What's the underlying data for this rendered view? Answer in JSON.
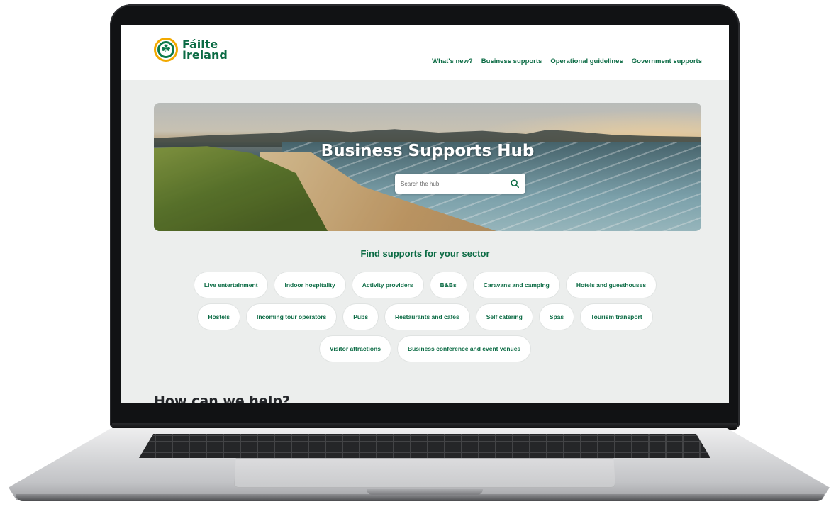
{
  "brand": {
    "logo_line1": "Fáilte",
    "logo_line2": "Ireland",
    "logo_icon": "shamrock-icon",
    "colors": {
      "primary_green": "#0b6b44",
      "logo_ring": "#f2a900"
    }
  },
  "nav": {
    "items": [
      "What's new?",
      "Business supports",
      "Operational guidelines",
      "Government supports"
    ]
  },
  "hero": {
    "title": "Business Supports Hub",
    "search_placeholder": "Search the hub",
    "search_icon": "search-icon"
  },
  "sectors": {
    "heading": "Find supports for your sector",
    "row1": [
      "Live entertainment",
      "Indoor hospitality",
      "Activity providers",
      "B&Bs",
      "Caravans and camping",
      "Hotels and guesthouses"
    ],
    "row2": [
      "Hostels",
      "Incoming tour operators",
      "Pubs",
      "Restaurants and cafes",
      "Self catering",
      "Spas",
      "Tourism transport"
    ],
    "row3": [
      "Visitor attractions",
      "Business conference and event venues"
    ]
  },
  "help": {
    "heading": "How can we help?"
  }
}
